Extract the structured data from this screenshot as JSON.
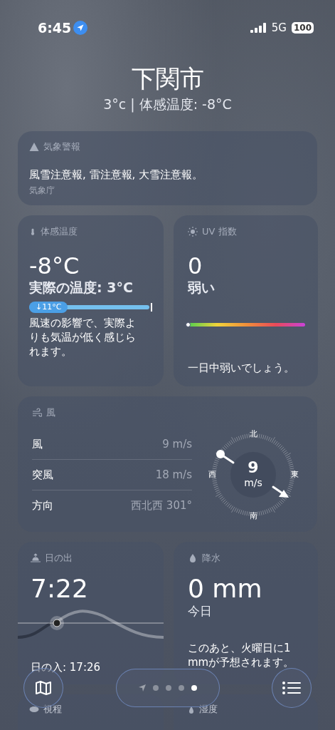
{
  "status_bar": {
    "time": "6:45",
    "network": "5G",
    "battery": "100"
  },
  "location": {
    "city": "下関市",
    "summary": "3°c | 体感温度: -8°C"
  },
  "alert": {
    "title": "気象警報",
    "text": "風雪注意報, 雷注意報, 大雪注意報。",
    "source": "気象庁"
  },
  "feels_like": {
    "title": "体感温度",
    "value": "-8°C",
    "actual": "実際の温度: 3°C",
    "badge": "↓11°C",
    "description": "風速の影響で、実際よりも気温が低く感じられます。"
  },
  "uv": {
    "title": "UV 指数",
    "value": "0",
    "rating": "弱い",
    "level": 0,
    "description": "一日中弱いでしょう。"
  },
  "wind": {
    "title": "風",
    "rows": [
      {
        "label": "風",
        "value": "9 m/s"
      },
      {
        "label": "突風",
        "value": "18 m/s"
      },
      {
        "label": "方向",
        "value": "西北西 301°"
      }
    ],
    "compass": {
      "north": "北",
      "east": "東",
      "south": "南",
      "west": "西",
      "speed": "9",
      "unit": "m/s"
    }
  },
  "sunrise": {
    "title": "日の出",
    "time": "7:22",
    "sunset": "日の入: 17:26"
  },
  "precipitation": {
    "title": "降水",
    "value": "0 mm",
    "period": "今日",
    "description": "このあと、火曜日に1 mmが予想されます。"
  },
  "next_cards": [
    {
      "kind": "visibility",
      "title": "視程"
    },
    {
      "kind": "humidity",
      "title": "湿度"
    }
  ],
  "pages": [
    {
      "kind": "location",
      "selected": false
    },
    {
      "kind": "dot",
      "selected": false
    },
    {
      "kind": "dot",
      "selected": false
    },
    {
      "kind": "dot",
      "selected": false
    },
    {
      "kind": "dot",
      "selected": true
    }
  ]
}
